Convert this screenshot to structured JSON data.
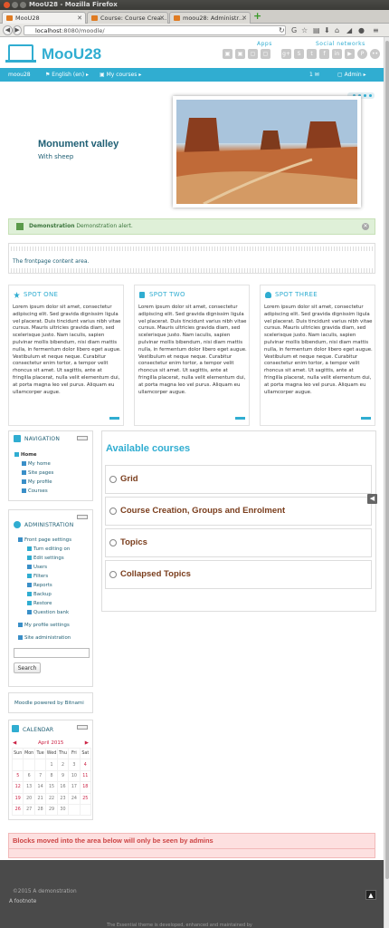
{
  "window": {
    "title": "MooU28 - Mozilla Firefox"
  },
  "tabs": [
    {
      "label": "MooU28",
      "active": true
    },
    {
      "label": "Course: Course Crea…",
      "active": false
    },
    {
      "label": "moou28: Administr…",
      "active": false
    }
  ],
  "navbar": {
    "url_host": "localhost",
    "url_path": ":8080/moodle/"
  },
  "header": {
    "site_name": "MooU28",
    "apps_label": "Apps",
    "social_label": "Social networks",
    "app_icons": [
      "cart-icon",
      "briefcase-icon",
      "window-icon",
      "window-icon"
    ],
    "social_icons": [
      "gplus-icon",
      "skype-icon",
      "twitter-icon",
      "facebook-icon",
      "linkedin-icon",
      "youtube-icon",
      "pinterest-icon",
      "flickr-icon"
    ]
  },
  "menu": {
    "home": "moou28",
    "language": "English (en)",
    "courses": "My courses",
    "messages": "1",
    "user": "Admin"
  },
  "slideshow": {
    "title": "Monument valley",
    "caption": "With sheep"
  },
  "alert": {
    "heading": "Demonstration",
    "text": "Demonstration alert."
  },
  "frontpage": {
    "content": "The frontpage content area."
  },
  "spots": [
    {
      "title": "SPOT ONE",
      "icon": "star-icon"
    },
    {
      "title": "SPOT TWO",
      "icon": "mobile-icon"
    },
    {
      "title": "SPOT THREE",
      "icon": "users-icon"
    }
  ],
  "spot_text": "Lorem ipsum dolor sit amet, consectetur adipiscing elit. Sed gravida dignissim ligula vel placerat. Duis tincidunt varius nibh vitae cursus. Mauris ultricies gravida diam, sed scelerisque justo. Nam iaculis, sapien pulvinar mollis bibendum, nisi diam mattis nulla, in fermentum dolor libero eget augue. Vestibulum et neque neque. Curabitur consectetur enim tortor, a tempor velit rhoncus sit amet. Ut sagittis, ante at fringilla placerat, nulla velit elementum dui, at porta magna leo vel purus. Aliquam eu ullamcorper augue.",
  "navigation": {
    "title": "NAVIGATION",
    "items": [
      "Home",
      "My home",
      "Site pages",
      "My profile",
      "Courses"
    ]
  },
  "administration": {
    "title": "ADMINISTRATION",
    "items": [
      "Front page settings",
      "Turn editing on",
      "Edit settings",
      "Users",
      "Filters",
      "Reports",
      "Backup",
      "Restore",
      "Question bank",
      "My profile settings",
      "Site administration"
    ],
    "search_button": "Search"
  },
  "bitnami": {
    "text": "Moodle powered by Bitnami"
  },
  "courses": {
    "title": "Available courses",
    "list": [
      "Grid",
      "Course Creation, Groups and Enrolment",
      "Topics",
      "Collapsed Topics"
    ]
  },
  "calendar": {
    "title": "CALENDAR",
    "month": "April 2015",
    "days": [
      "Sun",
      "Mon",
      "Tue",
      "Wed",
      "Thu",
      "Fri",
      "Sat"
    ],
    "weeks": [
      [
        "",
        "",
        "",
        "1",
        "2",
        "3",
        "4"
      ],
      [
        "5",
        "6",
        "7",
        "8",
        "9",
        "10",
        "11"
      ],
      [
        "12",
        "13",
        "14",
        "15",
        "16",
        "17",
        "18"
      ],
      [
        "19",
        "20",
        "21",
        "22",
        "23",
        "24",
        "25"
      ],
      [
        "26",
        "27",
        "28",
        "29",
        "30",
        "",
        ""
      ]
    ]
  },
  "admin_notice": {
    "text": "Blocks moved into the area below will only be seen by admins"
  },
  "footer": {
    "copyright": "©2015 A demonstration",
    "note": "A footnote",
    "credit": "The Essential theme is developed, enhanced and maintained by"
  },
  "colors": {
    "accent": "#30add1",
    "course_title": "#7a3d1c",
    "alert_bg": "#dff0d8",
    "admin_bg": "#fde0e0"
  }
}
